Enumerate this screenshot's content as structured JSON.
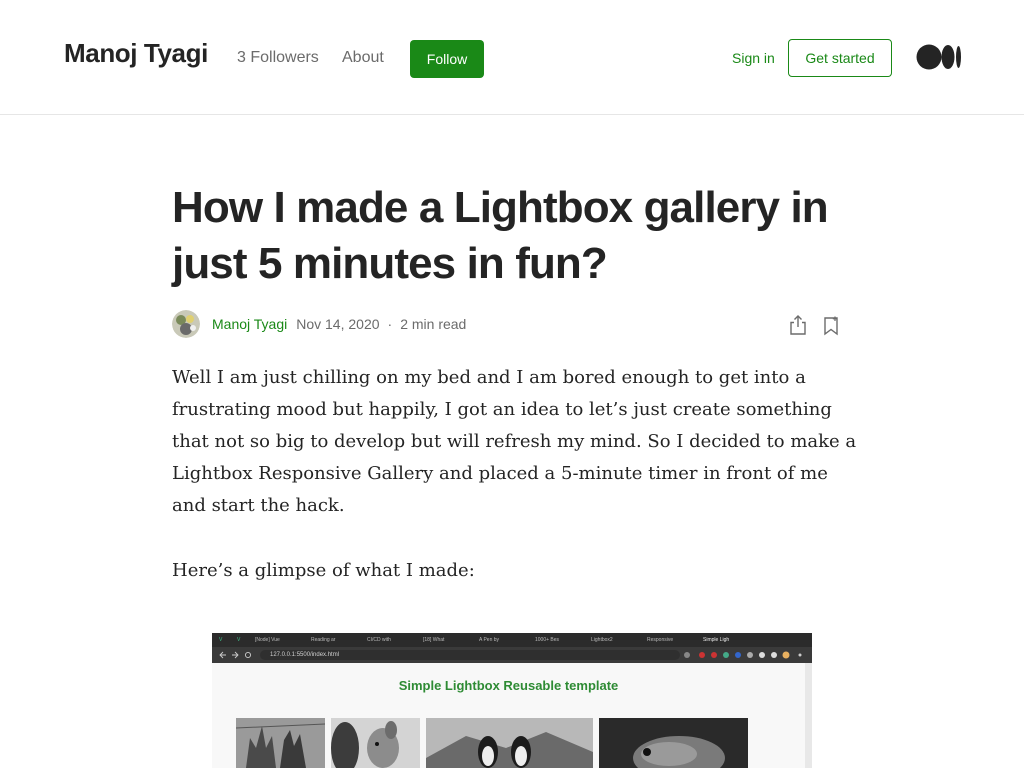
{
  "header": {
    "brand": "Manoj Tyagi",
    "followers": "3 Followers",
    "about": "About",
    "follow": "Follow",
    "sign_in": "Sign in",
    "get_started": "Get started",
    "logo_icon": "medium-logo"
  },
  "article": {
    "title": "How I made a Lightbox gallery in just 5 minutes in fun?",
    "author": "Manoj Tyagi",
    "date": "Nov 14, 2020",
    "separator": "·",
    "read_time": "2 min read",
    "paragraphs": [
      "Well I am just chilling on my bed and I am bored enough to get into a frustrating mood but happily, I got an idea to let’s just create something that not so big to develop but will refresh my mind. So I decided to make a Lightbox Responsive Gallery and placed a 5-minute timer in front of me and start the hack.",
      "Here’s a glimpse of what I made:"
    ]
  },
  "embedded_image": {
    "url": "127.0.0.1:5500/index.html",
    "heading": "Simple Lightbox Reusable template",
    "tabs": [
      "[Node] Vue",
      "Reading ar",
      "CI/CD with",
      "[18] What",
      "A Pen by",
      "1000+ Bes",
      "Lightbox2",
      "Responsive",
      "Simple Ligh"
    ]
  },
  "colors": {
    "accent_green": "#1a8917",
    "text": "#242424",
    "muted": "#6b6b6b"
  }
}
